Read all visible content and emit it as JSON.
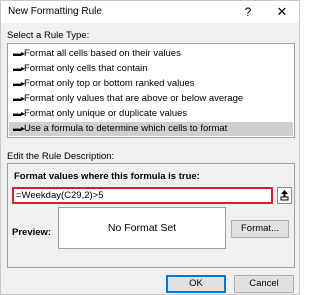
{
  "window": {
    "title": "New Formatting Rule",
    "help_glyph": "?",
    "close_glyph": "✕"
  },
  "rule_type": {
    "label": "Select a Rule Type:",
    "arrow_glyph": "▬▸",
    "items": [
      {
        "label": "Format all cells based on their values",
        "selected": false
      },
      {
        "label": "Format only cells that contain",
        "selected": false
      },
      {
        "label": "Format only top or bottom ranked values",
        "selected": false
      },
      {
        "label": "Format only values that are above or below average",
        "selected": false
      },
      {
        "label": "Format only unique or duplicate values",
        "selected": false
      },
      {
        "label": "Use a formula to determine which cells to format",
        "selected": true
      }
    ]
  },
  "description": {
    "label": "Edit the Rule Description:",
    "formula_label": "Format values where this formula is true:",
    "formula_value": "=Weekday(C29,2)>5",
    "preview_label": "Preview:",
    "preview_text": "No Format Set",
    "format_button": "Format..."
  },
  "buttons": {
    "ok": "OK",
    "cancel": "Cancel"
  },
  "colors": {
    "highlight_border": "#d8202a",
    "selected_row": "#cfcfcf",
    "default_button_border": "#0078d7"
  },
  "icons": {
    "collapse": "collapse-dialog-icon"
  }
}
